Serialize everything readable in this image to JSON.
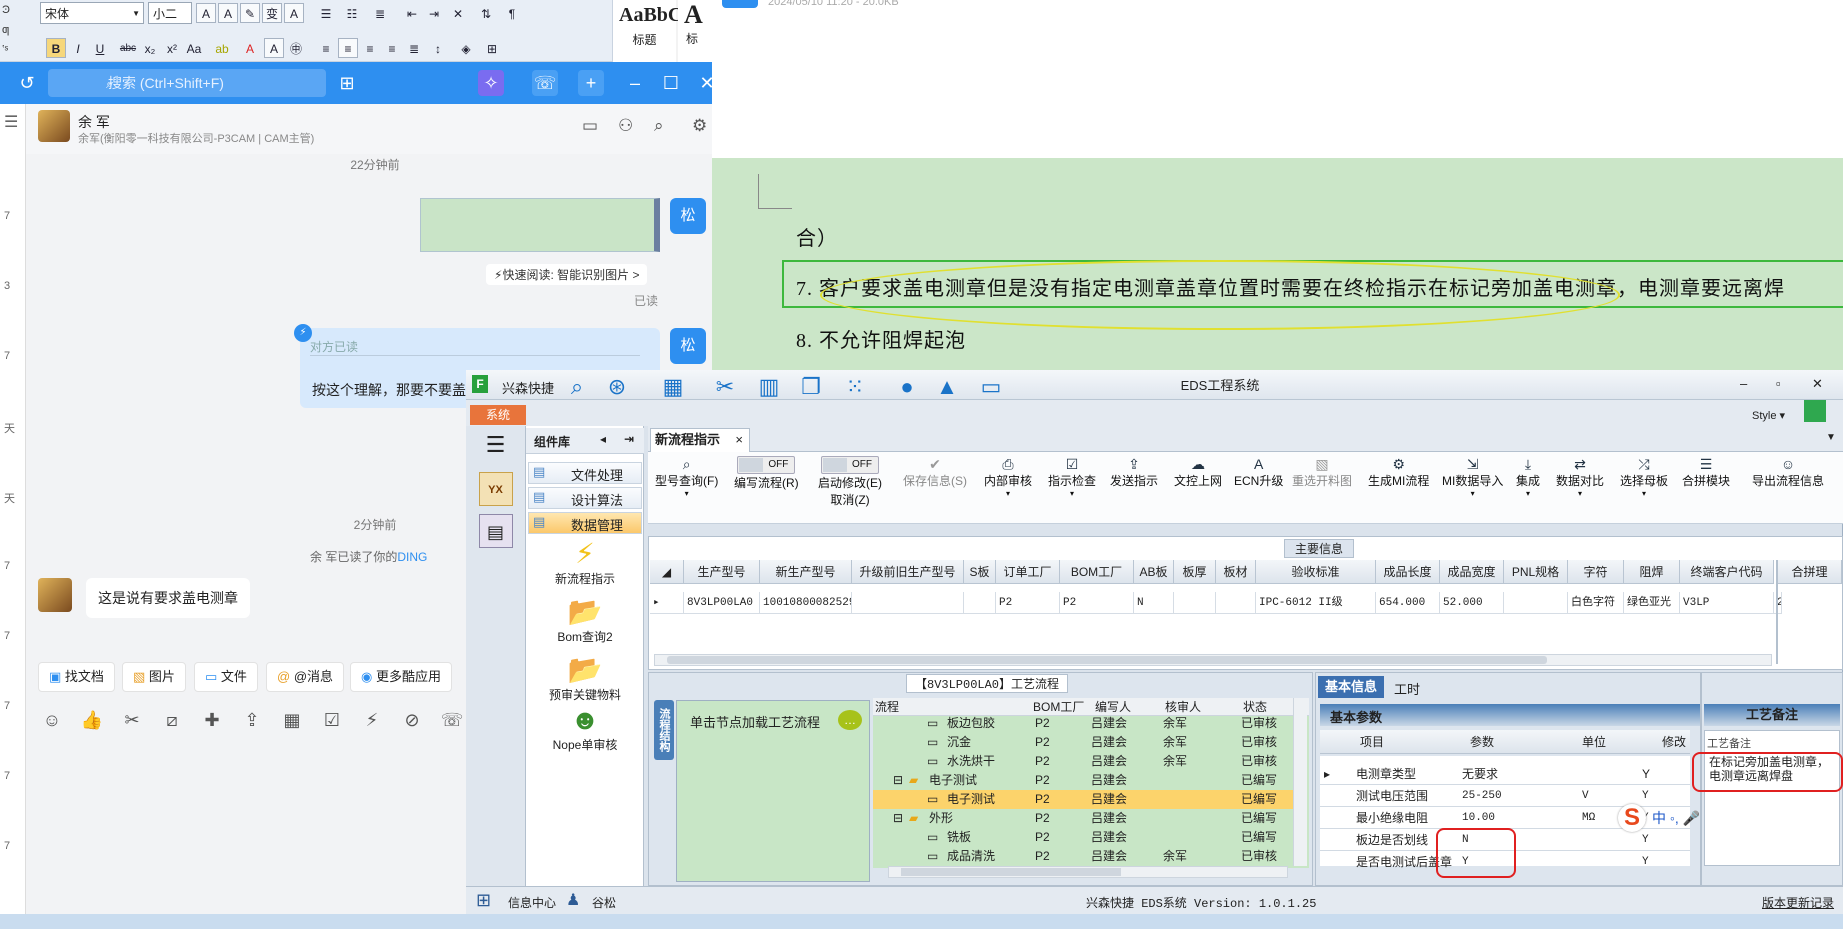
{
  "ribbon": {
    "side_labels": [
      "Ͽ",
      "ƣ",
      "ʽˢ"
    ],
    "font_name": "宋体",
    "font_size": "小二",
    "style_preview": "AaBbC",
    "style_name": "标题",
    "style_big": "A",
    "style_big_sub": "标"
  },
  "doc_header": {
    "file_meta": "2024/05/10 11:20 - 20.0KB"
  },
  "chat": {
    "search_placeholder": "搜索 (Ctrl+Shift+F)",
    "contact_name": "余 军",
    "contact_sub": "余军(衡阳零一科技有限公司-P3CAM | CAM主管)",
    "time1": "22分钟前",
    "quick_read": "快速阅读: 智能识别图片 >",
    "read1": "已读",
    "quote_label": "对方已读",
    "quote_text": "按这个理解，那要不要盖",
    "time2": "2分钟前",
    "read_notice_pre": "余 军已读了你的",
    "read_notice_link": "DING",
    "incoming_msg": "这是说有要求盖电测章",
    "my_avatar": "松",
    "side_nums": [
      "7",
      "3",
      "7",
      "天",
      "天",
      "7",
      "7",
      "7",
      "7",
      "7",
      "7"
    ],
    "quick_actions": [
      "找文档",
      "图片",
      "文件",
      "@消息",
      "更多酷应用"
    ]
  },
  "doc": {
    "line0": "合）",
    "line7": "7. 客户要求盖电测章但是没有指定电测章盖章位置时需要在终检指示在标记旁加盖电测章，电测章要远离焊",
    "line8": "8. 不允许阻焊起泡"
  },
  "eds": {
    "app_name": "兴森快捷",
    "window_title": "EDS工程系统",
    "style_label": "Style",
    "sys_tab": "系统",
    "nav_label": "YX",
    "component_title": "组件库",
    "components": [
      "文件处理",
      "设计算法",
      "数据管理"
    ],
    "big_components": [
      "新流程指示",
      "Bom查询2",
      "预审关键物料",
      "Nope单审核"
    ],
    "main_tab": "新流程指示",
    "toolbar": [
      {
        "label": "型号查询(F)",
        "icon": "search-icon"
      },
      {
        "label": "编写流程(R)",
        "icon": "toggle-icon",
        "toggle": "OFF"
      },
      {
        "label": "启动修改(E)",
        "sub": "取消(Z)",
        "icon": "toggle-icon",
        "toggle": "OFF"
      },
      {
        "label": "保存信息(S)",
        "icon": "check-icon",
        "disabled": true
      },
      {
        "label": "内部审核",
        "icon": "print-icon"
      },
      {
        "label": "指示检查",
        "icon": "checkbox-icon"
      },
      {
        "label": "发送指示",
        "icon": "upload-icon"
      },
      {
        "label": "文控上网",
        "icon": "cloud-icon"
      },
      {
        "label": "ECN升级",
        "icon": "a-icon"
      },
      {
        "label": "重选开料图",
        "icon": "image-icon",
        "disabled": true
      },
      {
        "label": "生成MI流程",
        "icon": "gears-icon"
      },
      {
        "label": "MI数据导入",
        "icon": "import-icon"
      },
      {
        "label": "集成",
        "icon": "download-icon"
      },
      {
        "label": "数据对比",
        "icon": "compare-icon"
      },
      {
        "label": "选择母板",
        "icon": "shuffle-icon"
      },
      {
        "label": "合拼模块",
        "icon": "list-icon"
      },
      {
        "label": "导出流程信息",
        "icon": "smile-icon"
      }
    ],
    "main_info_title": "主要信息",
    "grid_headers": [
      "生产型号",
      "新生产型号",
      "升级前旧生产型号",
      "S板",
      "订单工厂",
      "BOM工厂",
      "AB板",
      "板厚",
      "板材",
      "验收标准",
      "成品长度",
      "成品宽度",
      "PNL规格",
      "字符",
      "阻焊",
      "终端客户代码",
      "合拼理"
    ],
    "grid_row": [
      "8V3LP00LA0",
      "10010800082529",
      "",
      "",
      "P2",
      "P2",
      "N",
      "",
      "",
      "IPC-6012 II级",
      "654.000",
      "52.000",
      "",
      "白色字符",
      "绿色亚光",
      "V3LP",
      "2"
    ],
    "process_title": "【8V3LP00LA0】工艺流程",
    "process_vtab": "流程结构",
    "process_load": "单击节点加载工艺流程",
    "process_headers": [
      "流程",
      "BOM工厂",
      "编写人",
      "核审人",
      "状态"
    ],
    "process_rows": [
      {
        "name": "板边包胶",
        "bom": "P2",
        "writer": "吕建会",
        "reviewer": "余军",
        "status": "已审核"
      },
      {
        "name": "沉金",
        "bom": "P2",
        "writer": "吕建会",
        "reviewer": "余军",
        "status": "已审核"
      },
      {
        "name": "水洗烘干",
        "bom": "P2",
        "writer": "吕建会",
        "reviewer": "余军",
        "status": "已审核"
      },
      {
        "name": "电子测试",
        "bom": "P2",
        "writer": "吕建会",
        "reviewer": "",
        "status": "已编写",
        "group": true
      },
      {
        "name": "电子测试",
        "bom": "P2",
        "writer": "吕建会",
        "reviewer": "",
        "status": "已编写",
        "selected": true
      },
      {
        "name": "外形",
        "bom": "P2",
        "writer": "吕建会",
        "reviewer": "",
        "status": "已编写",
        "group": true
      },
      {
        "name": "铣板",
        "bom": "P2",
        "writer": "吕建会",
        "reviewer": "",
        "status": "已编写"
      },
      {
        "name": "成品清洗",
        "bom": "P2",
        "writer": "吕建会",
        "reviewer": "余军",
        "status": "已审核"
      }
    ],
    "basic_tabs": [
      "基本信息",
      "工时"
    ],
    "basic_sub": "基本参数",
    "basic_headers": [
      "项目",
      "参数",
      "单位",
      "修改"
    ],
    "basic_rows": [
      {
        "item": "电测章类型",
        "param": "无要求",
        "unit": "",
        "mod": "Y"
      },
      {
        "item": "测试电压范围",
        "param": "25-250",
        "unit": "V",
        "mod": "Y"
      },
      {
        "item": "最小绝缘电阻",
        "param": "10.00",
        "unit": "MΩ",
        "mod": "Y"
      },
      {
        "item": "板边是否划线",
        "param": "N",
        "unit": "",
        "mod": "Y"
      },
      {
        "item": "是否电测试后盖章",
        "param": "Y",
        "unit": "",
        "mod": "Y"
      }
    ],
    "note_tab": "工艺备注",
    "note_label": "工艺备注",
    "note_text": "在标记旁加盖电测章，电测章远离焊盘",
    "status_info": "信息中心",
    "status_user": "谷松",
    "status_version": "兴森快捷  EDS系统 Version: 1.0.1.25",
    "status_update": "版本更新记录"
  },
  "ime": {
    "label": "中"
  }
}
